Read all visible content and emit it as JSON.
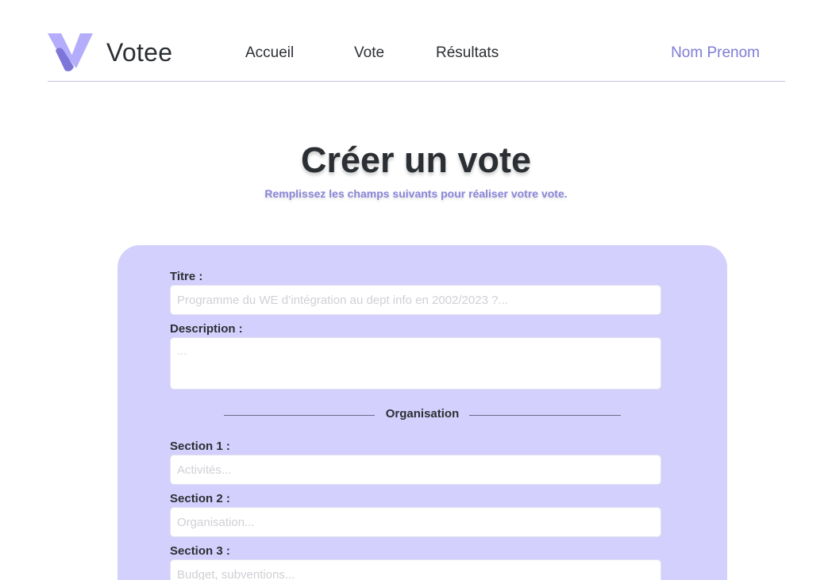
{
  "header": {
    "brand": "Votee",
    "nav": [
      "Accueil",
      "Vote",
      "Résultats"
    ],
    "user": "Nom Prenom",
    "logo_icon": "v-logo-icon",
    "colors": {
      "accent": "#7f7bd6",
      "logo_light": "#b3adfb",
      "logo_dark": "#7d76d8"
    }
  },
  "main": {
    "title": "Créer un vote",
    "subtitle": "Remplissez les champs suivants pour réaliser votre vote."
  },
  "form": {
    "background": "#d4d0fd",
    "title_label": "Titre :",
    "title_placeholder": "Programme du WE d’intégration au dept info en 2002/2023 ?...",
    "description_label": "Description :",
    "description_placeholder": "...",
    "divider_label": "Organisation",
    "sections": [
      {
        "label": "Section 1 :",
        "placeholder": "Activités..."
      },
      {
        "label": "Section 2 :",
        "placeholder": "Organisation..."
      },
      {
        "label": "Section 3 :",
        "placeholder": "Budget, subventions..."
      }
    ]
  }
}
